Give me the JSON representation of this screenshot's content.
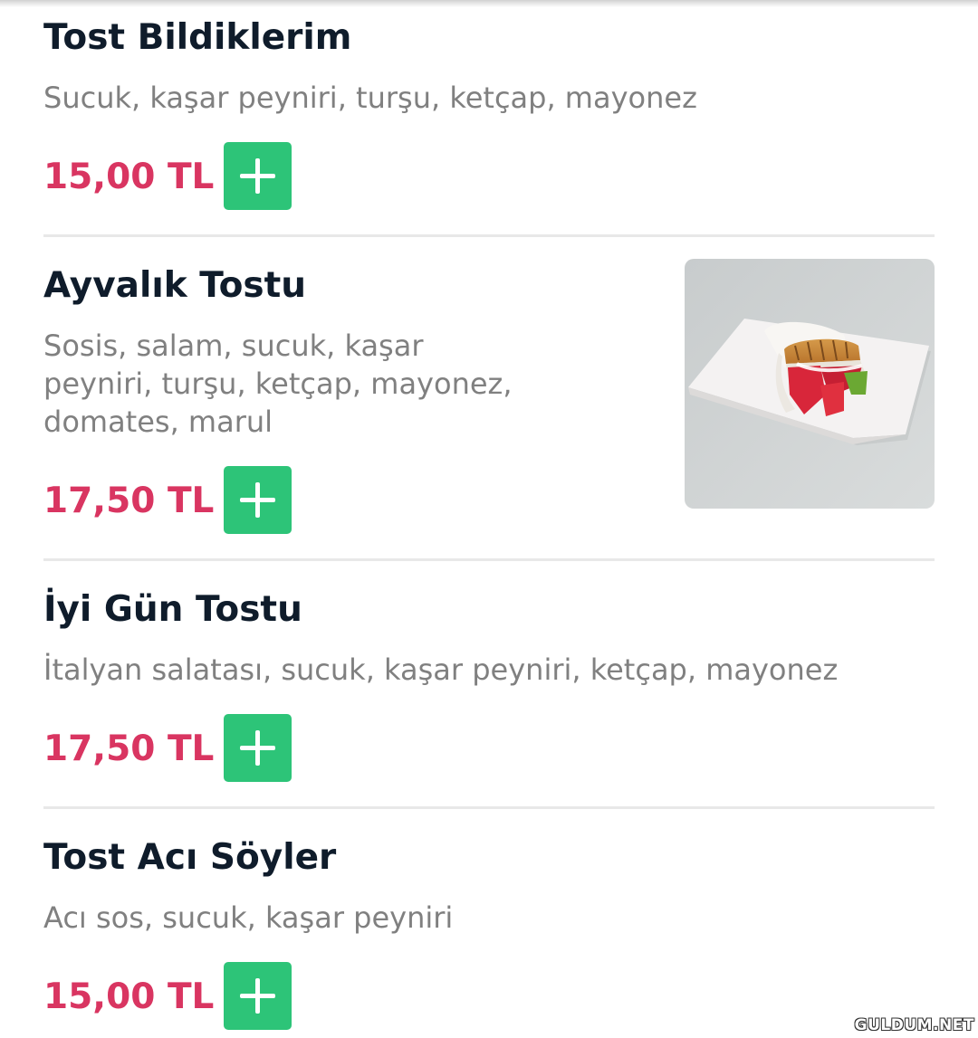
{
  "menu": {
    "items": [
      {
        "name": "Tost Bildiklerim",
        "description": "Sucuk, kaşar peyniri, turşu, ketçap, mayonez",
        "price": "15,00 TL",
        "add_icon": "plus-icon",
        "has_image": false
      },
      {
        "name": "Ayvalık Tostu",
        "description_lines": [
          "Sosis, salam, sucuk, kaşar",
          "peyniri, turşu, ketçap, mayonez,",
          "domates, marul"
        ],
        "price": "17,50 TL",
        "add_icon": "plus-icon",
        "has_image": true
      },
      {
        "name": "İyi Gün Tostu",
        "description": "İtalyan salatası, sucuk, kaşar peyniri, ketçap, mayonez",
        "price": "17,50 TL",
        "add_icon": "plus-icon",
        "has_image": false
      },
      {
        "name": "Tost Acı Söyler",
        "description": "Acı sos, sucuk, kaşar peyniri",
        "price": "15,00 TL",
        "add_icon": "plus-icon",
        "has_image": false
      }
    ]
  },
  "colors": {
    "background": "#ffffff",
    "title": "#0f1c2b",
    "description": "#808080",
    "price": "#d93561",
    "add_button": "#2dc478",
    "divider": "#e8e8e8"
  },
  "watermark": "GULDUM.NET"
}
